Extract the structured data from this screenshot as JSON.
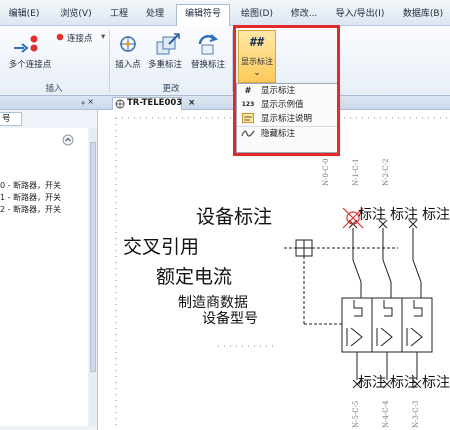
{
  "menu": {
    "tabs": [
      {
        "label": "编辑(E)"
      },
      {
        "label": "浏览(V)"
      },
      {
        "label": "工程"
      },
      {
        "label": "处理"
      },
      {
        "label": "编辑符号"
      },
      {
        "label": "绘图(D)"
      },
      {
        "label": "修改..."
      },
      {
        "label": "导入/导出(I)"
      },
      {
        "label": "数据库(B)"
      }
    ]
  },
  "ribbon": {
    "connect_label": "连接点",
    "multi_connect_label": "多个连接点",
    "insert_group_label": "插入",
    "insert_point_label": "插入点",
    "multi_tag_label": "多重标注",
    "replace_tag_label": "替换标注",
    "change_group_label": "更改",
    "show_tag_glyph": "##",
    "show_tag_label": "显示标注",
    "show_tag_arrow": "⌄"
  },
  "dropdown": {
    "items": [
      {
        "icon": "#",
        "label": "显示标注"
      },
      {
        "icon": "123",
        "label": "显示示例值"
      },
      {
        "icon": "",
        "label": "显示标注说明"
      },
      {
        "icon": "",
        "label": "隐藏标注"
      }
    ]
  },
  "left_panel": {
    "pin": "ᵩ ×",
    "tab_label": "号",
    "tree": [
      {
        "label": "0 - 断路器，开关"
      },
      {
        "label": "1 - 断路器，开关"
      },
      {
        "label": "2 - 断路器，开关"
      }
    ]
  },
  "document": {
    "tab_label": "TR-TELE003",
    "tab_close": "×"
  },
  "drawing": {
    "texts": {
      "device_tag": "设备标注",
      "cross_ref": "交叉引用",
      "rated_current": "额定电流",
      "manufacturer": "制造商数据",
      "device_model": "设备型号"
    },
    "top_tags": [
      "标注",
      "标注",
      "标注"
    ],
    "bottom_tags": [
      "标注",
      "标注",
      "标注"
    ],
    "top_terminals": [
      "N-0-C-0",
      "N-1-C-1",
      "N-2-C-2"
    ],
    "bottom_terminals": [
      "N-5-C-5",
      "N-4-C-4",
      "N-3-C-3"
    ]
  }
}
